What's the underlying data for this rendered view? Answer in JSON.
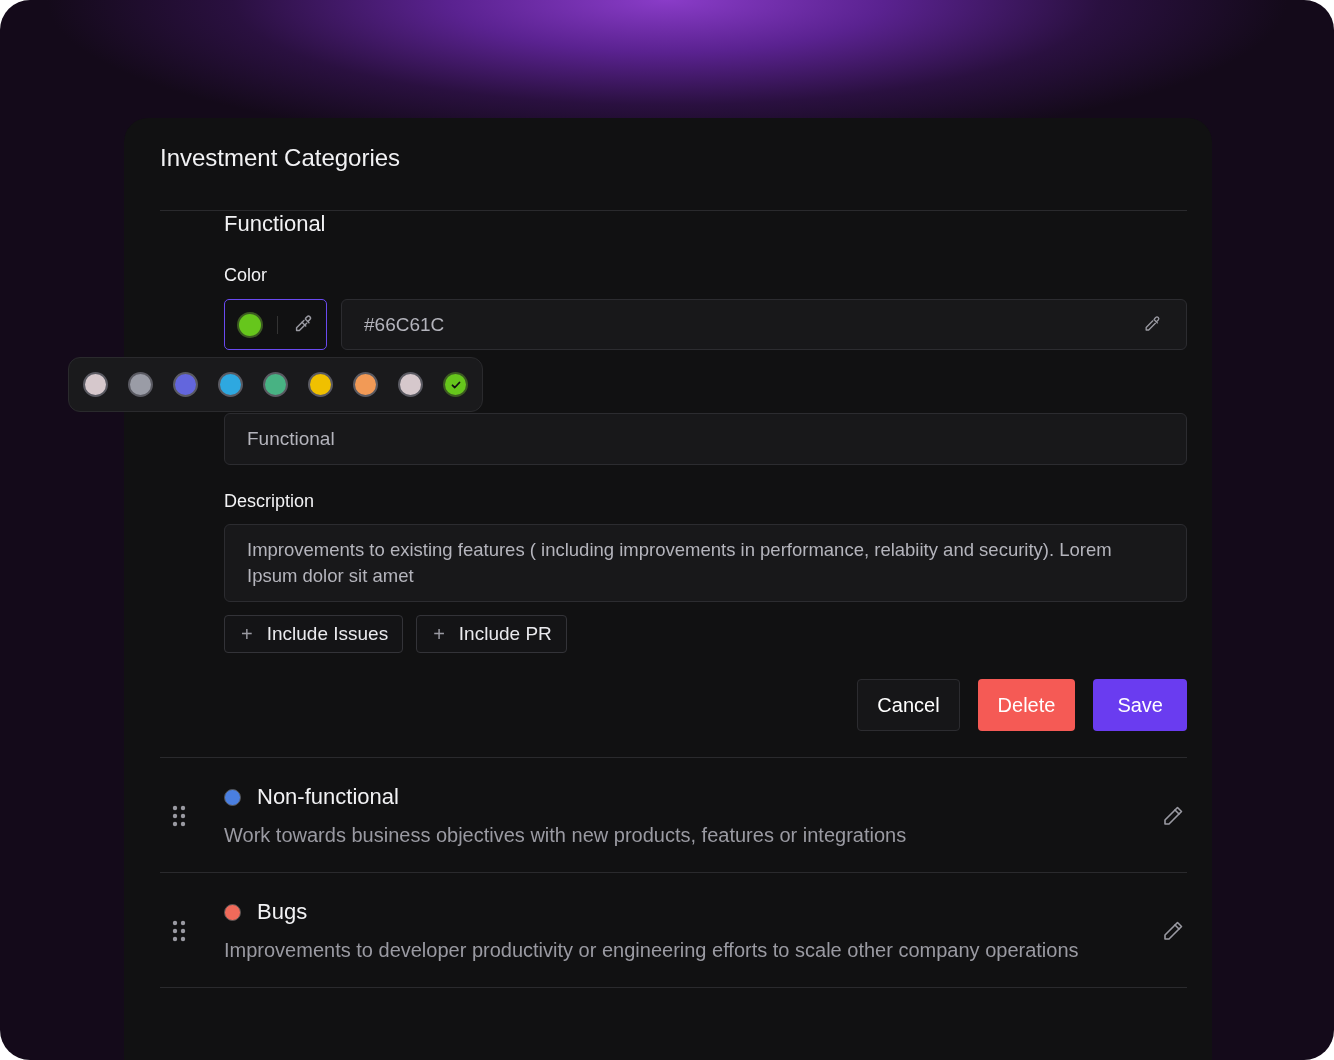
{
  "window": {
    "title": "Investment Categories"
  },
  "editor": {
    "title": "Functional",
    "color_label": "Color",
    "color": "#66c61c",
    "hex_value": "#66C61C",
    "swatches": [
      {
        "color": "#d6c8cc",
        "selected": false
      },
      {
        "color": "#9a9ca6",
        "selected": false
      },
      {
        "color": "#6366dd",
        "selected": false
      },
      {
        "color": "#2ea8e0",
        "selected": false
      },
      {
        "color": "#48b283",
        "selected": false
      },
      {
        "color": "#f0c000",
        "selected": false
      },
      {
        "color": "#f29a56",
        "selected": false
      },
      {
        "color": "#d6c8cc",
        "selected": false
      },
      {
        "color": "#66c61c",
        "selected": true
      }
    ],
    "name_value": "Functional",
    "description_label": "Description",
    "description_value": "Improvements to existing features ( including improvements in performance, relabiity and security). Lorem Ipsum dolor sit amet",
    "include_buttons": [
      {
        "icon": "+",
        "label": "Include Issues"
      },
      {
        "icon": "+",
        "label": "Include PR"
      }
    ],
    "actions": [
      {
        "label": "Cancel",
        "kind": "secondary"
      },
      {
        "label": "Delete",
        "kind": "danger"
      },
      {
        "label": "Save",
        "kind": "primary"
      }
    ]
  },
  "categories": [
    {
      "name": "Non-functional",
      "color": "#4a7fe0",
      "description": "Work towards business objectives with new products, features or integrations"
    },
    {
      "name": "Bugs",
      "color": "#f06a5a",
      "description": "Improvements to developer productivity or engineering efforts to scale other company operations"
    }
  ]
}
